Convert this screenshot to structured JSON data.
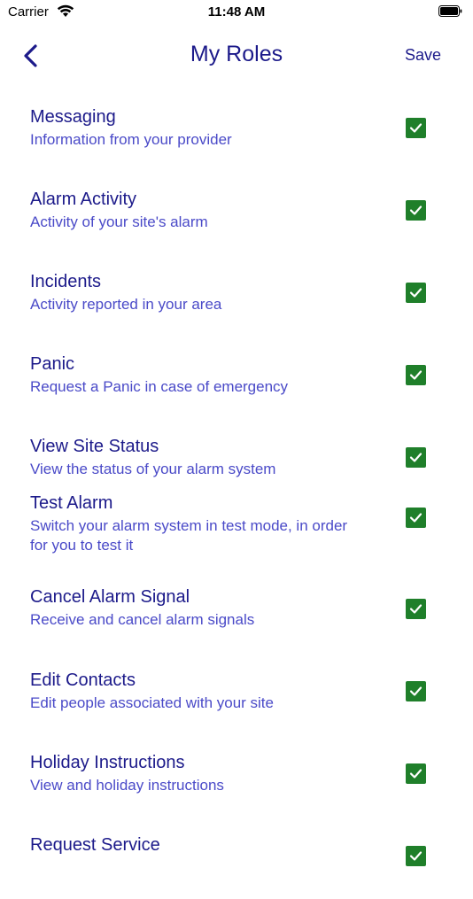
{
  "status_bar": {
    "carrier": "Carrier",
    "time": "11:48 AM"
  },
  "nav": {
    "title": "My Roles",
    "save_label": "Save"
  },
  "roles": [
    {
      "name": "Messaging",
      "description": "Information from your provider",
      "checked": true
    },
    {
      "name": "Alarm Activity",
      "description": "Activity of your site's alarm",
      "checked": true
    },
    {
      "name": "Incidents",
      "description": "Activity reported in your area",
      "checked": true
    },
    {
      "name": "Panic",
      "description": "Request a Panic in case of emergency",
      "checked": true
    },
    {
      "name": "View Site Status",
      "description": "View the status of your alarm system",
      "checked": true
    },
    {
      "name": "Test Alarm",
      "description": "Switch your alarm system in test mode,  in order for you to test it",
      "checked": true
    },
    {
      "name": "Cancel Alarm Signal",
      "description": "Receive and cancel alarm signals",
      "checked": true
    },
    {
      "name": "Edit Contacts",
      "description": "Edit people associated with your site",
      "checked": true
    },
    {
      "name": "Holiday Instructions",
      "description": "View and holiday instructions",
      "checked": true
    },
    {
      "name": "Request Service",
      "description": "",
      "checked": true
    }
  ]
}
